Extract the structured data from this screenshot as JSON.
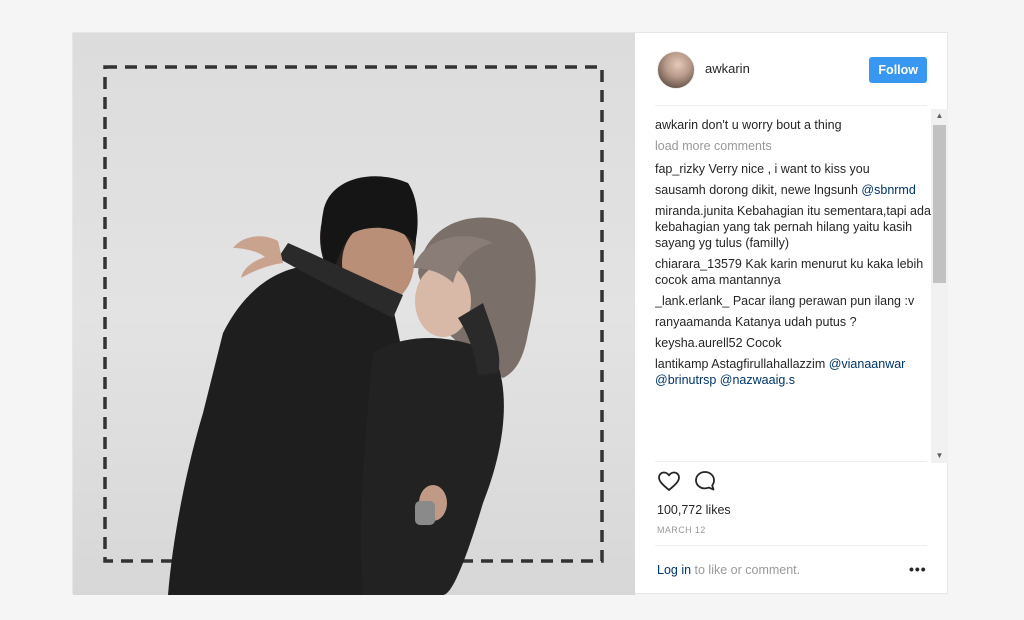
{
  "post": {
    "username": "awkarin",
    "follow_label": "Follow",
    "caption": {
      "user": "awkarin",
      "text": "don't u worry bout a thing"
    },
    "load_more_label": "load more comments",
    "comments": [
      {
        "user": "fap_rizky",
        "text": "Verry nice , i want to kiss you"
      },
      {
        "user": "sausamh",
        "text": "dorong dikit, newe lngsunh",
        "mention": "@sbnrmd"
      },
      {
        "user": "miranda.junita",
        "text": "Kebahagian itu sementara,tapi ada kebahagian yang tak pernah hilang yaitu kasih sayang yg tulus (familly)"
      },
      {
        "user": "chiarara_13579",
        "text": "Kak karin menurut ku kaka lebih cocok ama mantannya"
      },
      {
        "user": "_lank.erlank_",
        "text": "Pacar ilang perawan pun ilang :v"
      },
      {
        "user": "ranyaamanda",
        "text": "Katanya udah putus ?"
      },
      {
        "user": "keysha.aurell52",
        "text": "Cocok"
      },
      {
        "user": "lantikamp",
        "text": "Astagfirullahallazzim",
        "mention": "@vianaanwar @brinutrsp @nazwaaig.s"
      }
    ],
    "likes_label": "100,772 likes",
    "date": "MARCH 12",
    "login_link": "Log in",
    "login_rest": " to like or comment.",
    "more_label": "•••"
  },
  "icons": {
    "like": "heart-icon",
    "comment": "comment-bubble-icon",
    "scroll_up": "▲",
    "scroll_down": "▼"
  },
  "colors": {
    "accent": "#3897f0",
    "link": "#003569",
    "muted": "#999999"
  }
}
